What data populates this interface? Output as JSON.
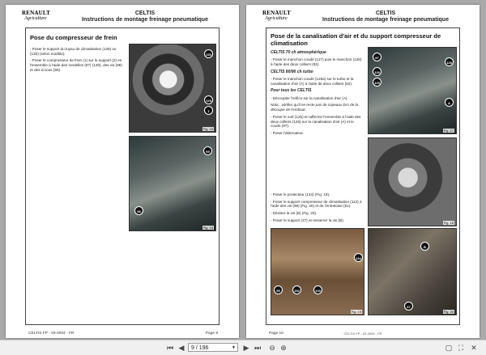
{
  "left_page": {
    "logo_brand": "RENAULT",
    "logo_sub": "Agriculture",
    "header_model": "CELTIS",
    "header_subtitle": "Instructions de montage freinage pneumatique",
    "section_title": "Pose du compresseur de frein",
    "paragraphs": [
      "- Poser le support du tuyau de climatisation (129) ou (130) (selon modèle).",
      "- Poser le compresseur de frein (1) sur le support (2) en l'ensemble à l'aide des rondelles (97) (130), des vis (98) et des écrous (96)."
    ],
    "photo1_caption": "Fig. 15",
    "photo2_caption": "Fig. 16",
    "photo1_callouts": [
      "130",
      "129",
      "1"
    ],
    "photo2_callouts": [
      "99",
      "98"
    ],
    "footer_left": "CELTIS FP - 03-2004 - FR",
    "footer_right": "Page 9"
  },
  "right_page": {
    "logo_brand": "RENAULT",
    "logo_sub": "Agriculture",
    "header_model": "CELTIS",
    "header_subtitle": "Instructions de montage freinage pneumatique",
    "section_title": "Pose de la canalisation d'air et du support compresseur de climatisation",
    "subhead1": "CELTIS 70 ch atmosphérique",
    "para1": "- Poser le manchon coudé (127) puis le manchon (128) à l'aide des deux colliers (92).",
    "subhead2": "CELTIS 80/90 ch turbo",
    "para2": "- Poser le manchon coudé (128a) sur le turbo et la canalisation d'air (A) à l'aide de deux colliers (92).",
    "subhead3": "Pour tous les CELTIS",
    "para3": "- Découpler l'orifice sur la canalisation d'air (A).",
    "note3": "Nota : vérifier qu'il ne reste pas de copeaux lors de la découpe de l'embout.",
    "para3b": "- Poser le ouït (125) et raffermir l'ensemble à l'aide des deux colliers (126) sur la canalisation d'air (A) et le coude (97).",
    "para4": "- Poser l'alternateur.",
    "para5": "- Poser le protecteur (134) (Fig. 19).",
    "para6": "- Poser le support compresseur de climatisation (112) à l'aide des vis (99) (Fig. 20) et de l'entretoise (51).",
    "para7": "- Déviser la vis (B) (Fig. 20).",
    "para8": "- Poser le support (47) et resserrer la vis (B).",
    "photo1_caption": "Fig. 17",
    "photo2_caption": "Fig. 18",
    "photo3_caption": "Fig. 19",
    "photo4_caption": "Fig. 20",
    "photo1_callouts": [
      "97",
      "126",
      "125",
      "128",
      "A"
    ],
    "photo3_callouts": [
      "134",
      "95",
      "152",
      "140"
    ],
    "photo4_callouts": [
      "B",
      "47"
    ],
    "footer_left": "Page 10",
    "footer_center": "CELTIS FP - 03-2004 - FR"
  },
  "toolbar": {
    "page_display": "9 / 196",
    "first_icon": "first-page-icon",
    "prev_icon": "previous-page-icon",
    "next_icon": "next-page-icon",
    "last_icon": "last-page-icon",
    "zoom_out_icon": "zoom-out-icon",
    "zoom_in_icon": "zoom-in-icon",
    "fit_icon": "fit-page-icon",
    "fullscreen_icon": "fullscreen-icon",
    "close_icon": "close-icon"
  }
}
